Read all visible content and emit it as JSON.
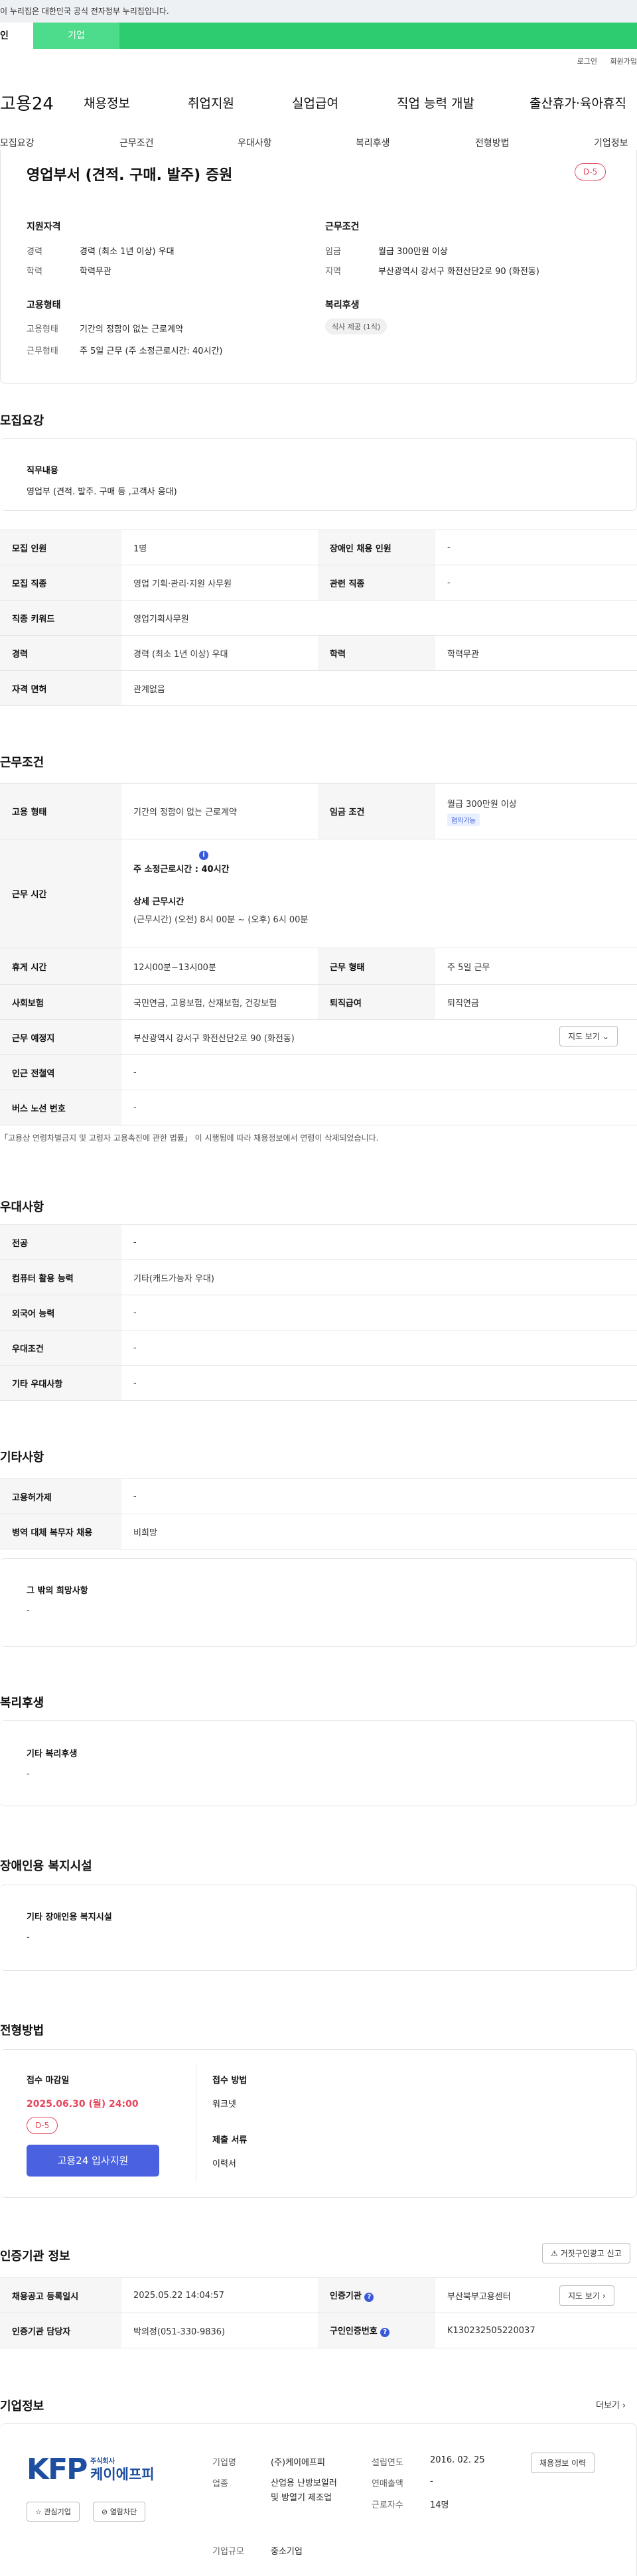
{
  "gov_banner": "이 누리집은 대한민국 공식 전자정부 누리집입니다.",
  "top_tabs": [
    {
      "label": "인"
    },
    {
      "label": "기업"
    }
  ],
  "util_links": [
    "로그인",
    "회원가입"
  ],
  "gnb": {
    "logo": "고용24",
    "menu": [
      "채용정보",
      "취업지원",
      "실업급여",
      "직업 능력 개발",
      "출산휴가·육아휴직"
    ]
  },
  "anchor_nav": [
    "모집요강",
    "근무조건",
    "우대사항",
    "복리후생",
    "전형방법",
    "기업정보"
  ],
  "summary": {
    "title": "영업부서 (견적. 구매. 발주) 증원",
    "dday": "D-5",
    "qualification_label": "지원자격",
    "career_k": "경력",
    "career_v": "경력 (최소 1년 이상) 우대",
    "edu_k": "학력",
    "edu_v": "학력무관",
    "employment_label": "고용형태",
    "emp_type_k": "고용형태",
    "emp_type_v": "기간의 정함이 없는 근로계약",
    "work_form_k": "근무형태",
    "work_form_v": "주 5일 근무 (주 소정근로시간: 40시간)",
    "condition_label": "근무조건",
    "wage_k": "임금",
    "wage_v": "월급 300만원 이상",
    "region_k": "지역",
    "region_v": "부산광역시 강서구 화전산단2로 90 (화전동)",
    "welfare_label": "복리후생",
    "welfare_chip": "식사 제공 (1식)"
  },
  "recruit": {
    "title": "모집요강",
    "duty_label": "직무내용",
    "duty_text": "영업부 (견적. 발주. 구매 등 ,고객사 응대)",
    "rows": {
      "headcount_k": "모집 인원",
      "headcount_v": "1명",
      "disabled_k": "장애인 채용 인원",
      "disabled_v": "-",
      "job_k": "모집 직종",
      "job_v": "영업 기획·관리·지원 사무원",
      "related_k": "관련 직종",
      "related_v": "-",
      "keyword_k": "직종 키워드",
      "keyword_v": "영업기획사무원",
      "career_k": "경력",
      "career_v": "경력 (최소 1년 이상) 우대",
      "edu_k": "학력",
      "edu_v": "학력무관",
      "license_k": "자격 면허",
      "license_v": "관계없음"
    }
  },
  "work": {
    "title": "근무조건",
    "emp_k": "고용 형태",
    "emp_v": "기간의 정함이 없는 근로계약",
    "wage_k": "임금 조건",
    "wage_v": "월급 300만원 이상",
    "wage_badge": "협의가능",
    "hours_k": "근무 시간",
    "hours_weekly": "주 소정근로시간 : 40시간",
    "hours_detail_label": "상세 근무시간",
    "hours_detail": "(근무시간) (오전) 8시 00분 ~ (오후) 6시 00분",
    "break_k": "휴게 시간",
    "break_v": "12시00분~13시00분",
    "form_k": "근무 형태",
    "form_v": "주 5일 근무",
    "insurance_k": "사회보험",
    "insurance_v": "국민연금, 고용보험, 산재보험, 건강보험",
    "severance_k": "퇴직급여",
    "severance_v": "퇴직연금",
    "place_k": "근무 예정지",
    "place_v": "부산광역시 강서구 화전산단2로 90 (화전동)",
    "map_btn": "지도 보기",
    "subway_k": "인근 전철역",
    "subway_v": "-",
    "bus_k": "버스 노선 번호",
    "bus_v": "-",
    "note": "「고용상 연령차별금지 및 고령자 고용촉진에 관한 법률」 이 시행됨에 따라 채용정보에서 연령이 삭제되었습니다."
  },
  "prefer": {
    "title": "우대사항",
    "major_k": "전공",
    "major_v": "-",
    "pc_k": "컴퓨터 활용 능력",
    "pc_v": "기타(캐드가능자 우대)",
    "lang_k": "외국어 능력",
    "lang_v": "-",
    "cond_k": "우대조건",
    "cond_v": "-",
    "etc_k": "기타 우대사항",
    "etc_v": "-"
  },
  "etc": {
    "title": "기타사항",
    "shift_k": "고용허가제",
    "shift_v": "-",
    "military_k": "병역 대체 복무자 채용",
    "military_v": "비희망",
    "wish_label": "그 밖의 희망사항",
    "wish_v": "-"
  },
  "welfare": {
    "title": "복리후생",
    "label": "기타 복리후생",
    "value": "-"
  },
  "disabled": {
    "title": "장애인용 복지시설",
    "label": "기타 장애인용 복지시설",
    "value": "-"
  },
  "selection": {
    "title": "전형방법",
    "deadline_label": "접수 마감일",
    "deadline": "2025.06.30 (월) 24:00",
    "dday": "D-5",
    "apply_btn": "고용24 입사지원",
    "method_label": "접수 방법",
    "method_v": "워크넷",
    "docs_label": "제출 서류",
    "docs_v": "이력서"
  },
  "cert": {
    "title": "인증기관 정보",
    "report_btn": "거짓구인광고 신고",
    "reg_k": "채용공고 등록일시",
    "reg_v": "2025.05.22 14:04:57",
    "org_k": "인증기관",
    "org_v": "부산북부고용센터",
    "map_btn": "지도 보기",
    "staff_k": "인증기관 담당자",
    "staff_v": "박의정(051-330-9836)",
    "num_k": "구인인증번호",
    "num_v": "K130232505220037"
  },
  "company": {
    "title": "기업정보",
    "more": "더보기",
    "logo_text": "KFP",
    "logo_sub1": "주식회사",
    "logo_sub2": "케이에프피",
    "interest_btn": "관심기업",
    "block_btn": "열람차단",
    "name_k": "기업명",
    "name_v": "(주)케이에프피",
    "industry_k": "업종",
    "industry_v": "산업용 난방보일러 및 방열기 제조업",
    "size_k": "기업규모",
    "size_v": "중소기업",
    "founded_k": "설립연도",
    "founded_v": "2016. 02. 25",
    "sales_k": "연매출액",
    "sales_v": "-",
    "employees_k": "근로자수",
    "employees_v": "14명",
    "history_btn": "채용정보 이력"
  }
}
